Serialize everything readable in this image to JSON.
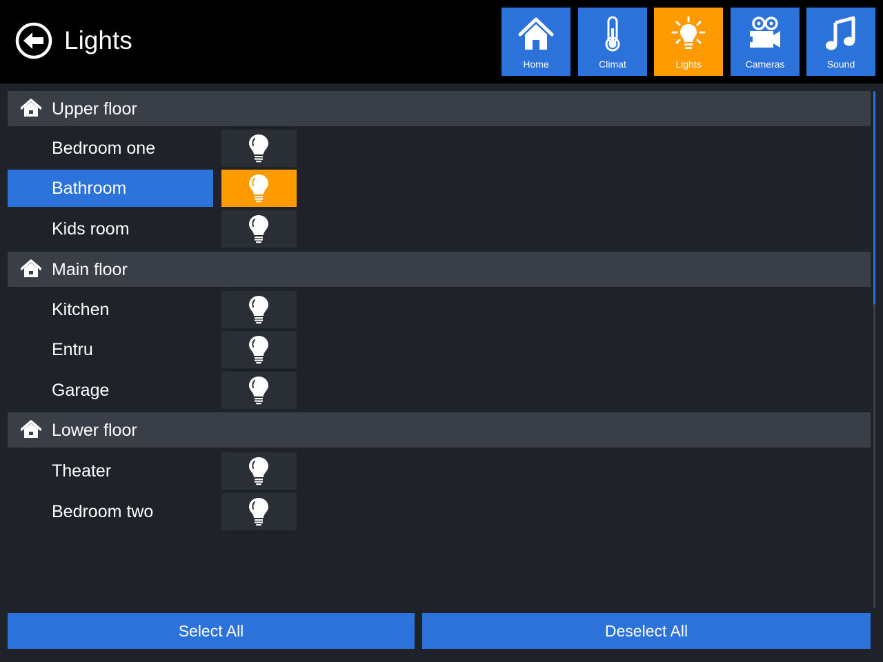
{
  "header": {
    "title": "Lights",
    "back_icon": "back-arrow-icon"
  },
  "nav": {
    "home": {
      "label": "Home",
      "icon": "home-icon"
    },
    "climat": {
      "label": "Climat",
      "icon": "thermometer-icon"
    },
    "lights": {
      "label": "Lights",
      "icon": "lightbulb-icon",
      "active": true
    },
    "cameras": {
      "label": "Cameras",
      "icon": "camera-icon"
    },
    "sound": {
      "label": "Sound",
      "icon": "music-note-icon"
    }
  },
  "sections": [
    {
      "title": "Upper floor",
      "rooms": [
        {
          "name": "Bedroom one",
          "on": false
        },
        {
          "name": "Bathroom",
          "on": true,
          "selected": true
        },
        {
          "name": "Kids room",
          "on": false
        }
      ]
    },
    {
      "title": "Main floor",
      "rooms": [
        {
          "name": "Kitchen",
          "on": false
        },
        {
          "name": "Entru",
          "on": false
        },
        {
          "name": "Garage",
          "on": false
        }
      ]
    },
    {
      "title": "Lower floor",
      "rooms": [
        {
          "name": "Theater",
          "on": false
        },
        {
          "name": "Bedroom two",
          "on": false
        }
      ]
    }
  ],
  "footer": {
    "select_all": "Select All",
    "deselect_all": "Deselect All"
  },
  "colors": {
    "accent_blue": "#2b73db",
    "accent_orange": "#ff9a00",
    "background": "#1f2229",
    "section_header": "#3a3e47",
    "toggle_off": "#2a2e35",
    "topbar": "#000000"
  }
}
